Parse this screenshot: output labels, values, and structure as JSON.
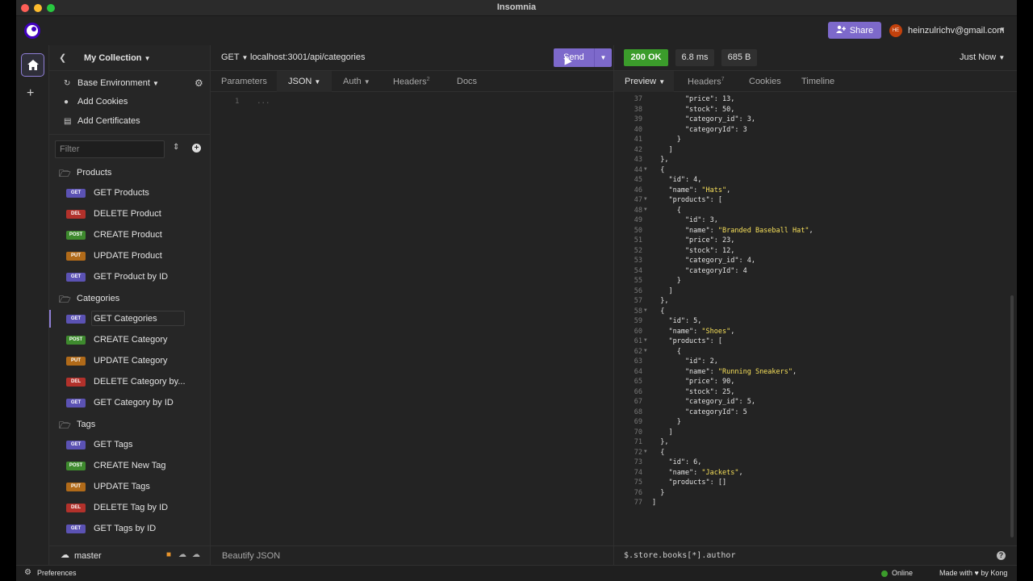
{
  "app": {
    "title": "Insomnia"
  },
  "colors": {
    "accent": "#7d69cb",
    "ok": "#3b9c2b",
    "get": "#5b52b3",
    "post": "#3e8a2e",
    "put": "#b06a19",
    "del": "#b2312b",
    "json_string": "#f7e05a"
  },
  "topbar": {
    "share_label": "Share",
    "avatar_initials": "HE",
    "user_email": "heinzulrichv@gmail.com"
  },
  "sidebar": {
    "collection_title": "My Collection",
    "environment_label": "Base Environment",
    "add_cookies": "Add Cookies",
    "add_certificates": "Add Certificates",
    "filter_placeholder": "Filter",
    "folders": [
      {
        "name": "Products",
        "requests": [
          {
            "method": "GET",
            "name": "GET Products"
          },
          {
            "method": "DEL",
            "name": "DELETE Product"
          },
          {
            "method": "POST",
            "name": "CREATE Product"
          },
          {
            "method": "PUT",
            "name": "UPDATE Product"
          },
          {
            "method": "GET",
            "name": "GET Product by ID"
          }
        ]
      },
      {
        "name": "Categories",
        "requests": [
          {
            "method": "GET",
            "name": "GET Categories"
          },
          {
            "method": "POST",
            "name": "CREATE Category"
          },
          {
            "method": "PUT",
            "name": "UPDATE Category"
          },
          {
            "method": "DEL",
            "name": "DELETE Category by..."
          },
          {
            "method": "GET",
            "name": "GET Category by ID"
          }
        ]
      },
      {
        "name": "Tags",
        "requests": [
          {
            "method": "GET",
            "name": "GET Tags"
          },
          {
            "method": "POST",
            "name": "CREATE New Tag"
          },
          {
            "method": "PUT",
            "name": "UPDATE Tags"
          },
          {
            "method": "DEL",
            "name": "DELETE Tag by ID"
          },
          {
            "method": "GET",
            "name": "GET Tags by ID"
          }
        ]
      }
    ],
    "branch": "master"
  },
  "request": {
    "method": "GET",
    "url": "localhost:3001/api/categories",
    "send_label": "Send",
    "tabs": {
      "parameters": "Parameters",
      "json": "JSON",
      "auth": "Auth",
      "headers": "Headers",
      "headers_count": "2",
      "docs": "Docs"
    },
    "editor_line_number": "1",
    "editor_placeholder": "...",
    "footer": "Beautify JSON"
  },
  "response": {
    "status": "200 OK",
    "time": "6.8 ms",
    "size": "685 B",
    "timestamp": "Just Now",
    "tabs": {
      "preview": "Preview",
      "headers": "Headers",
      "headers_count": "7",
      "cookies": "Cookies",
      "timeline": "Timeline"
    },
    "filter_text": "$.store.books[*].author",
    "lines": [
      {
        "n": "37",
        "f": "",
        "t": "        \"price\": 13,"
      },
      {
        "n": "38",
        "f": "",
        "t": "        \"stock\": 50,"
      },
      {
        "n": "39",
        "f": "",
        "t": "        \"category_id\": 3,"
      },
      {
        "n": "40",
        "f": "",
        "t": "        \"categoryId\": 3"
      },
      {
        "n": "41",
        "f": "",
        "t": "      }"
      },
      {
        "n": "42",
        "f": "",
        "t": "    ]"
      },
      {
        "n": "43",
        "f": "",
        "t": "  },"
      },
      {
        "n": "44",
        "f": "▼",
        "t": "  {"
      },
      {
        "n": "45",
        "f": "",
        "t": "    \"id\": 4,"
      },
      {
        "n": "46",
        "f": "",
        "t": "    \"name\": \"Hats\","
      },
      {
        "n": "47",
        "f": "▼",
        "t": "    \"products\": ["
      },
      {
        "n": "48",
        "f": "▼",
        "t": "      {"
      },
      {
        "n": "49",
        "f": "",
        "t": "        \"id\": 3,"
      },
      {
        "n": "50",
        "f": "",
        "t": "        \"name\": \"Branded Baseball Hat\","
      },
      {
        "n": "51",
        "f": "",
        "t": "        \"price\": 23,"
      },
      {
        "n": "52",
        "f": "",
        "t": "        \"stock\": 12,"
      },
      {
        "n": "53",
        "f": "",
        "t": "        \"category_id\": 4,"
      },
      {
        "n": "54",
        "f": "",
        "t": "        \"categoryId\": 4"
      },
      {
        "n": "55",
        "f": "",
        "t": "      }"
      },
      {
        "n": "56",
        "f": "",
        "t": "    ]"
      },
      {
        "n": "57",
        "f": "",
        "t": "  },"
      },
      {
        "n": "58",
        "f": "▼",
        "t": "  {"
      },
      {
        "n": "59",
        "f": "",
        "t": "    \"id\": 5,"
      },
      {
        "n": "60",
        "f": "",
        "t": "    \"name\": \"Shoes\","
      },
      {
        "n": "61",
        "f": "▼",
        "t": "    \"products\": ["
      },
      {
        "n": "62",
        "f": "▼",
        "t": "      {"
      },
      {
        "n": "63",
        "f": "",
        "t": "        \"id\": 2,"
      },
      {
        "n": "64",
        "f": "",
        "t": "        \"name\": \"Running Sneakers\","
      },
      {
        "n": "65",
        "f": "",
        "t": "        \"price\": 90,"
      },
      {
        "n": "66",
        "f": "",
        "t": "        \"stock\": 25,"
      },
      {
        "n": "67",
        "f": "",
        "t": "        \"category_id\": 5,"
      },
      {
        "n": "68",
        "f": "",
        "t": "        \"categoryId\": 5"
      },
      {
        "n": "69",
        "f": "",
        "t": "      }"
      },
      {
        "n": "70",
        "f": "",
        "t": "    ]"
      },
      {
        "n": "71",
        "f": "",
        "t": "  },"
      },
      {
        "n": "72",
        "f": "▼",
        "t": "  {"
      },
      {
        "n": "73",
        "f": "",
        "t": "    \"id\": 6,"
      },
      {
        "n": "74",
        "f": "",
        "t": "    \"name\": \"Jackets\","
      },
      {
        "n": "75",
        "f": "",
        "t": "    \"products\": []"
      },
      {
        "n": "76",
        "f": "",
        "t": "  }"
      },
      {
        "n": "77",
        "f": "",
        "t": "]"
      }
    ]
  },
  "statusbar": {
    "preferences": "Preferences",
    "online": "Online",
    "made_with": "Made with ♥ by Kong"
  }
}
